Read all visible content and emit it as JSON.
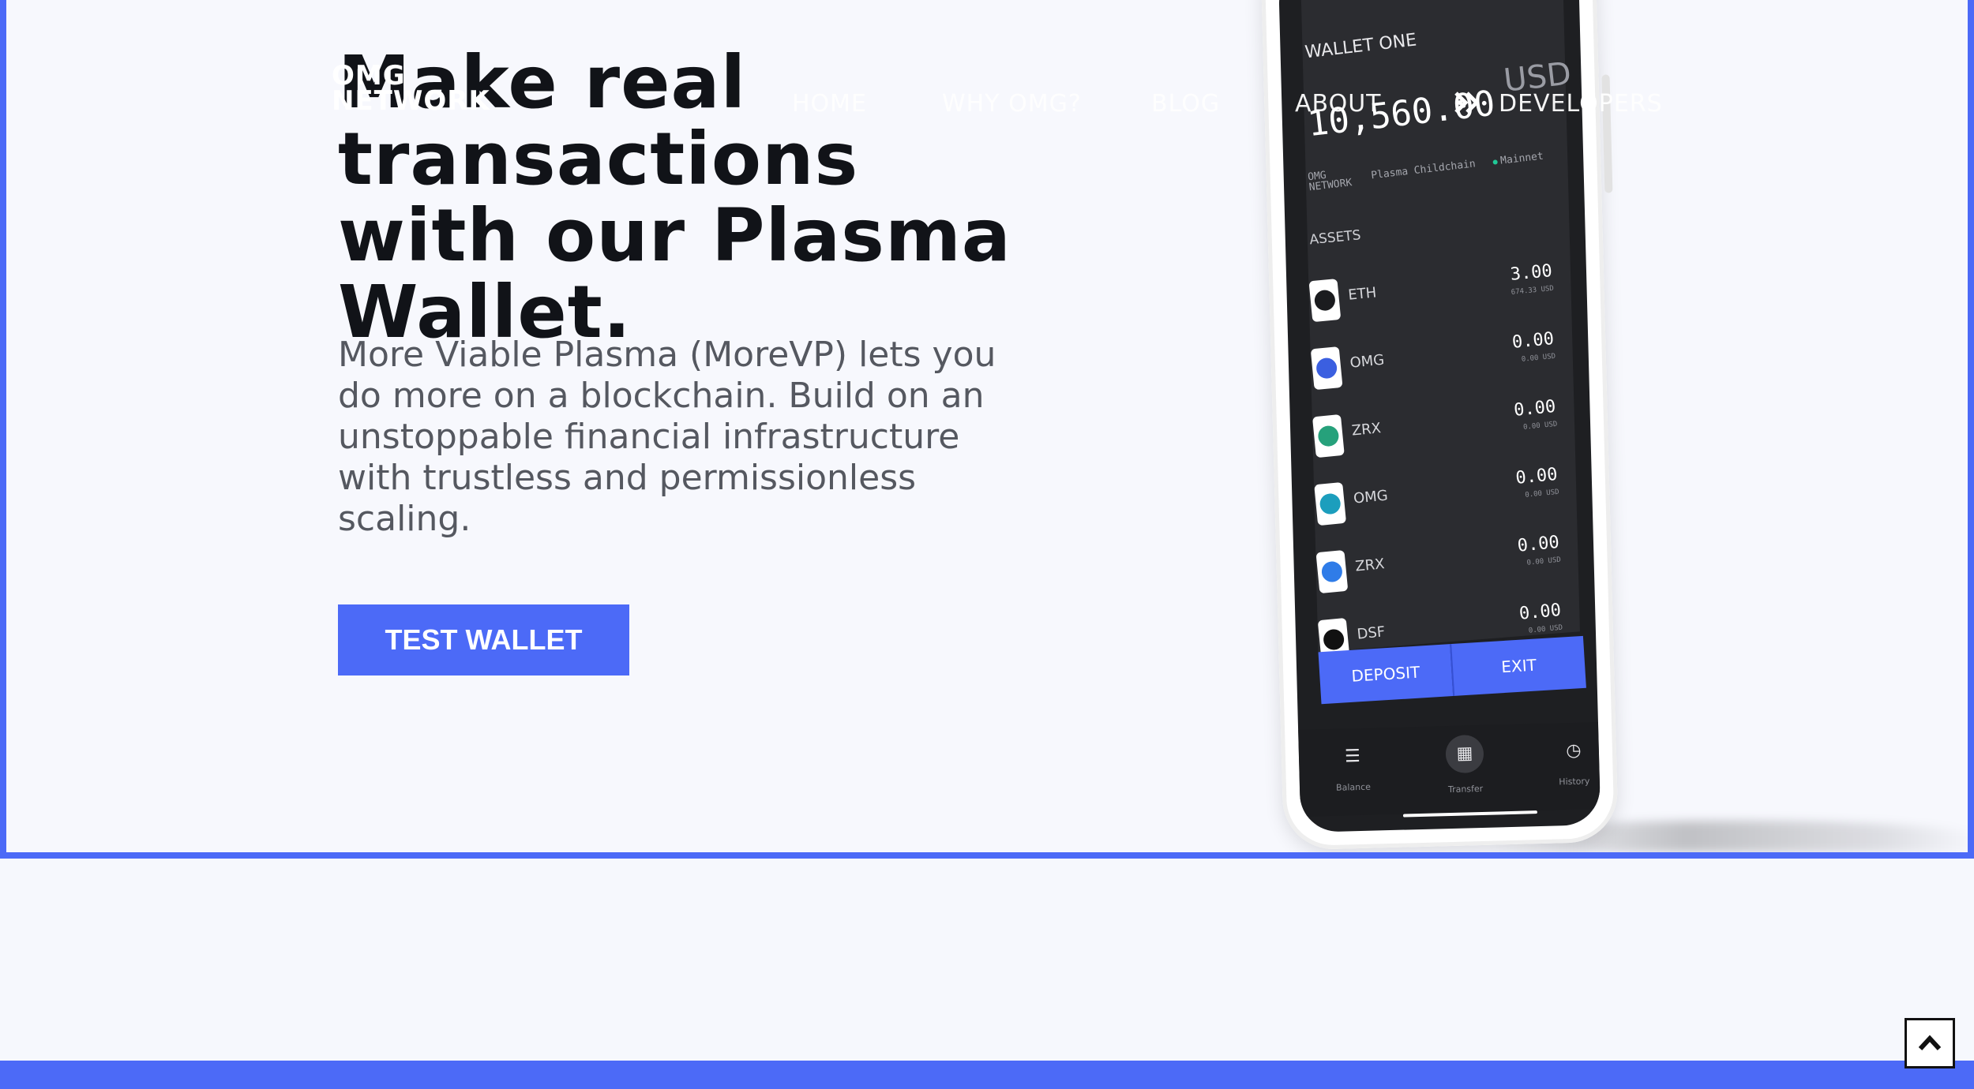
{
  "nav": {
    "logo_line1": "OMG",
    "logo_line2": "NETWORK",
    "links": [
      "HOME",
      "WHY OMG?",
      "BLOG",
      "ABOUT",
      "DEVELOPERS"
    ]
  },
  "hero": {
    "headline": "Make real transactions with our Plasma Wallet.",
    "body": "More Viable Plasma (MoreVP) lets you do more on a blockchain. Build on an unstoppable financial infrastructure with trustless and permissionless scaling.",
    "cta_label": "TEST WALLET"
  },
  "phone": {
    "wallet_name": "WALLET ONE",
    "balance": "10,560.00",
    "currency": "USD",
    "network_brand": "OMG NETWORK",
    "network_name": "Plasma Childchain",
    "network_status": "Mainnet",
    "assets_label": "ASSETS",
    "assets": [
      {
        "symbol": "ETH",
        "amount": "3.00",
        "usd": "674.33 USD",
        "icon": "ethereum-icon",
        "color": "#1b1c1f"
      },
      {
        "symbol": "OMG",
        "amount": "0.00",
        "usd": "0.00 USD",
        "icon": "omg-token-icon",
        "color": "#3b5fe0"
      },
      {
        "symbol": "ZRX",
        "amount": "0.00",
        "usd": "0.00 USD",
        "icon": "tether-icon",
        "color": "#26a17b"
      },
      {
        "symbol": "OMG",
        "amount": "0.00",
        "usd": "0.00 USD",
        "icon": "circle-c-icon",
        "color": "#1c9ebd"
      },
      {
        "symbol": "ZRX",
        "amount": "0.00",
        "usd": "0.00 USD",
        "icon": "stripes-icon",
        "color": "#2f7ce8"
      },
      {
        "symbol": "DSF",
        "amount": "0.00",
        "usd": "0.00 USD",
        "icon": "x-ring-icon",
        "color": "#111111"
      }
    ],
    "deposit_label": "DEPOSIT",
    "exit_label": "EXIT",
    "tabs": [
      "Balance",
      "Transfer",
      "History"
    ]
  },
  "colors": {
    "accent": "#4c6af7",
    "background": "#f7f8fd",
    "headline": "#111318",
    "body": "#555860"
  }
}
